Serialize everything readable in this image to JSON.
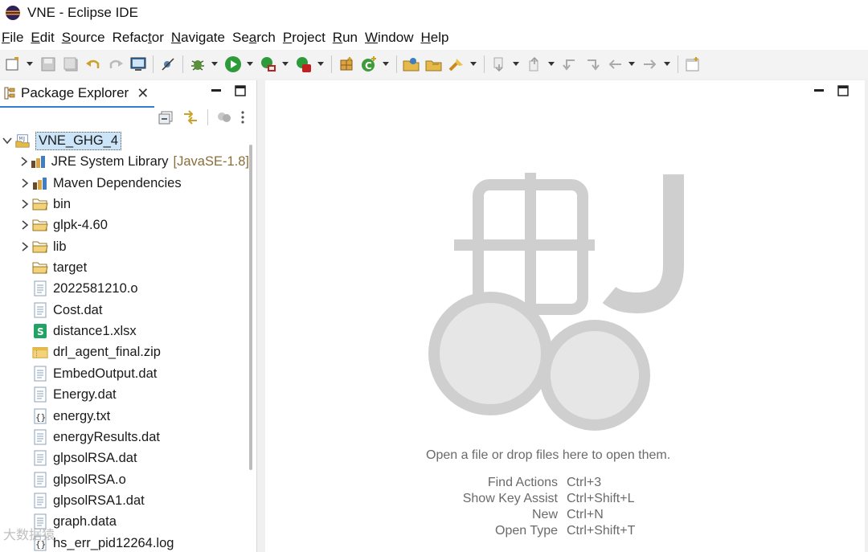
{
  "window": {
    "title": "VNE - Eclipse IDE"
  },
  "menubar": {
    "items": [
      {
        "first": "F",
        "rest": "ile"
      },
      {
        "first": "E",
        "rest": "dit"
      },
      {
        "first": "S",
        "rest": "ource"
      },
      {
        "first": "",
        "rest": "Refac",
        "mn": "t",
        "tail": "or"
      },
      {
        "first": "N",
        "rest": "avigate"
      },
      {
        "first": "",
        "rest": "Se",
        "mn": "a",
        "tail": "rch"
      },
      {
        "first": "P",
        "rest": "roject"
      },
      {
        "first": "R",
        "rest": "un"
      },
      {
        "first": "W",
        "rest": "indow"
      },
      {
        "first": "H",
        "rest": "elp"
      }
    ]
  },
  "package_explorer": {
    "tab_title": "Package Explorer",
    "tree": [
      {
        "label": "VNE_GHG_4",
        "icon": "project-icon",
        "expanded": true
      },
      {
        "label": "JRE System Library",
        "decoration": "[JavaSE-1.8]",
        "icon": "library-icon"
      },
      {
        "label": "Maven Dependencies",
        "icon": "library-icon"
      },
      {
        "label": "bin",
        "icon": "folder-icon"
      },
      {
        "label": "glpk-4.60",
        "icon": "folder-icon"
      },
      {
        "label": "lib",
        "icon": "folder-icon"
      },
      {
        "label": "target",
        "icon": "folder-icon"
      },
      {
        "label": "2022581210.o",
        "icon": "file-icon"
      },
      {
        "label": "Cost.dat",
        "icon": "file-icon"
      },
      {
        "label": "distance1.xlsx",
        "icon": "spreadsheet-icon"
      },
      {
        "label": "drl_agent_final.zip",
        "icon": "zip-icon"
      },
      {
        "label": "EmbedOutput.dat",
        "icon": "file-icon"
      },
      {
        "label": "Energy.dat",
        "icon": "file-icon"
      },
      {
        "label": "energy.txt",
        "icon": "json-file-icon"
      },
      {
        "label": "energyResults.dat",
        "icon": "file-icon"
      },
      {
        "label": "glpsolRSA.dat",
        "icon": "file-icon"
      },
      {
        "label": "glpsolRSA.o",
        "icon": "file-icon"
      },
      {
        "label": "glpsolRSA1.dat",
        "icon": "file-icon"
      },
      {
        "label": "graph.data",
        "icon": "file-icon"
      },
      {
        "label": "hs_err_pid12264.log",
        "icon": "json-file-icon"
      }
    ]
  },
  "editor": {
    "hint": "Open a file or drop files here to open them.",
    "shortcuts": [
      {
        "name": "Find Actions",
        "key": "Ctrl+3"
      },
      {
        "name": "Show Key Assist",
        "key": "Ctrl+Shift+L"
      },
      {
        "name": "New",
        "key": "Ctrl+N"
      },
      {
        "name": "Open Type",
        "key": "Ctrl+Shift+T"
      }
    ]
  },
  "watermark": "大数据猿"
}
